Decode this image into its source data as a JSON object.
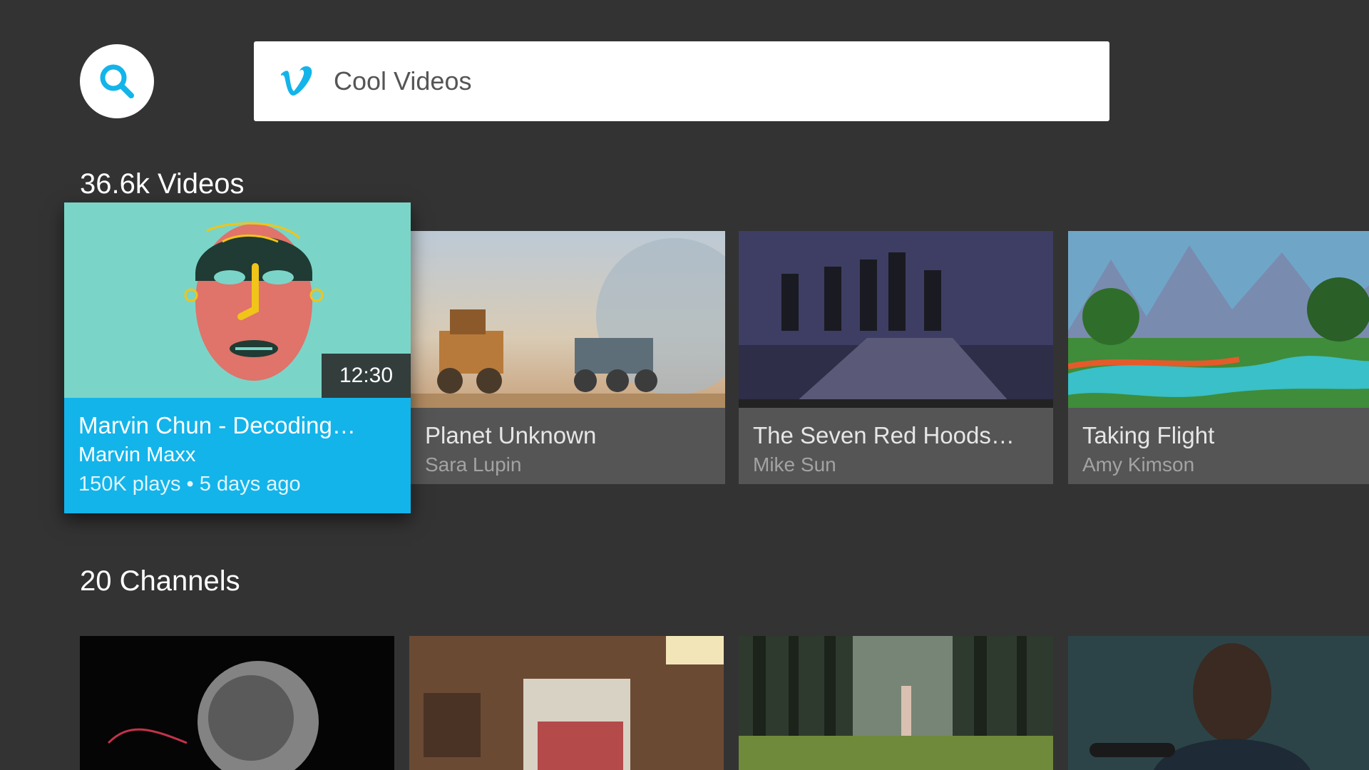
{
  "search": {
    "query": "Cool Videos",
    "icon": "search-icon",
    "logo": "vimeo-logo"
  },
  "videos_section": {
    "title": "36.6k Videos",
    "items": [
      {
        "title": "Marvin Chun - Decoding…",
        "author": "Marvin Maxx",
        "meta": "150K plays • 5 days ago",
        "duration": "12:30",
        "focused": true
      },
      {
        "title": "Planet Unknown",
        "author": "Sara Lupin"
      },
      {
        "title": "The Seven Red Hoods…",
        "author": "Mike Sun"
      },
      {
        "title": "Taking Flight",
        "author": "Amy Kimson"
      }
    ]
  },
  "channels_section": {
    "title": "20 Channels"
  },
  "colors": {
    "background": "#333333",
    "accent": "#13b4ea",
    "card": "#555555"
  }
}
